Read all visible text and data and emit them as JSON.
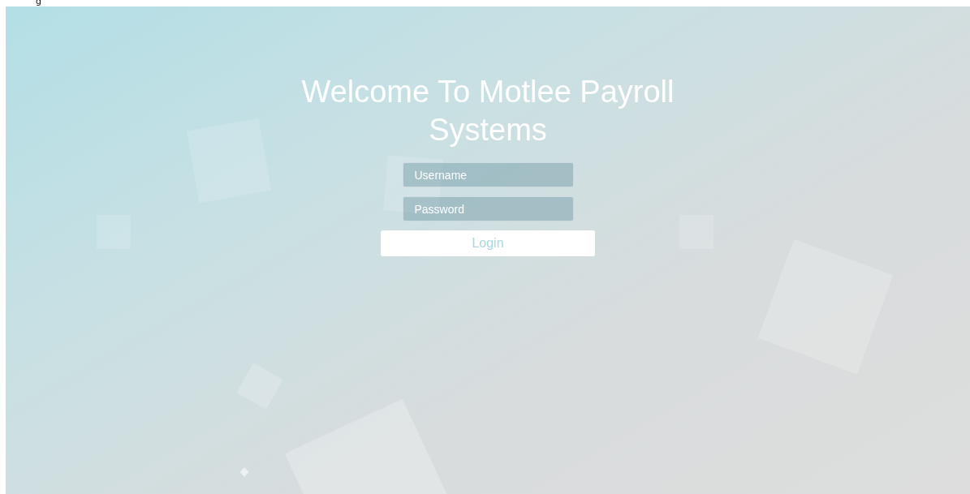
{
  "header": {
    "text": "g"
  },
  "title": "Welcome To Motlee Payroll Systems",
  "username": {
    "placeholder": "Username"
  },
  "password": {
    "placeholder": "Password"
  },
  "login_button": "Login"
}
